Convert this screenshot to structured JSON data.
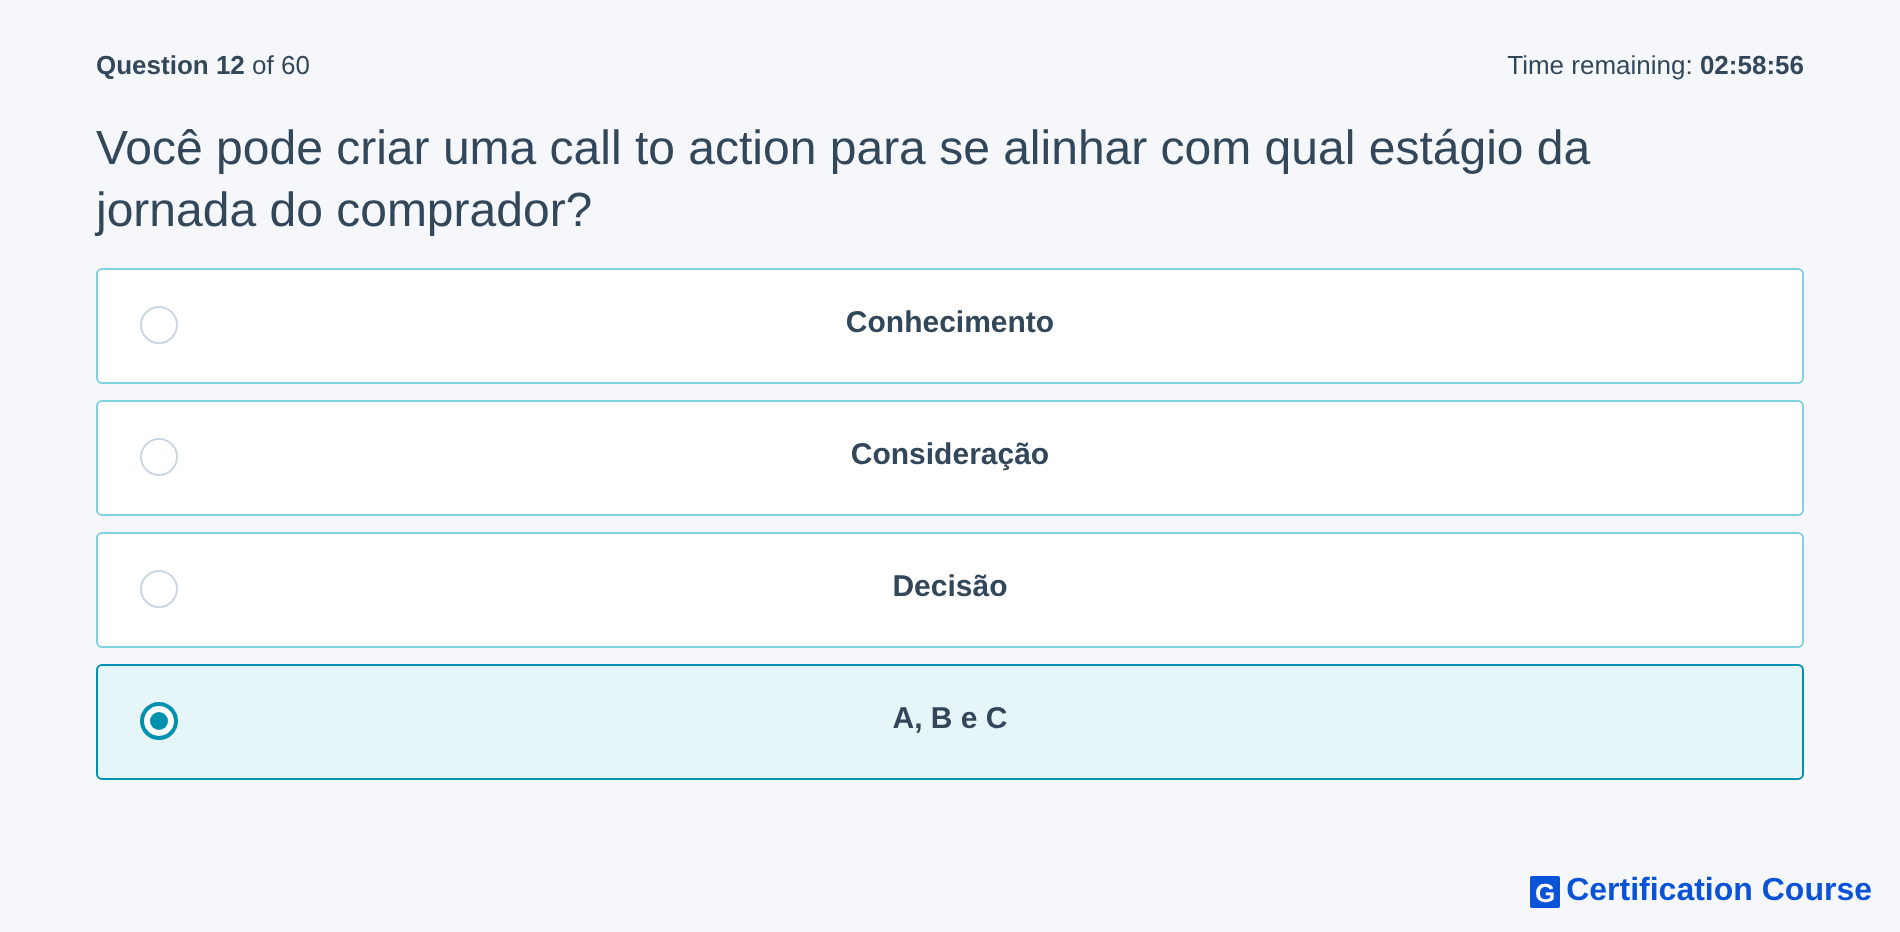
{
  "header": {
    "progress": "**Question 12** of 60",
    "timer": "Time remaining: **02:58:56**"
  },
  "question": "Você pode criar uma call to action para se alinhar com qual estágio da jornada do comprador?",
  "options": [
    {
      "label": "Conhecimento",
      "selected": false
    },
    {
      "label": "Consideração",
      "selected": false
    },
    {
      "label": "Decisão",
      "selected": false
    },
    {
      "label": "A, B e C",
      "selected": true
    }
  ],
  "brand": {
    "logo_letter": "G",
    "name": "Certification Course"
  }
}
